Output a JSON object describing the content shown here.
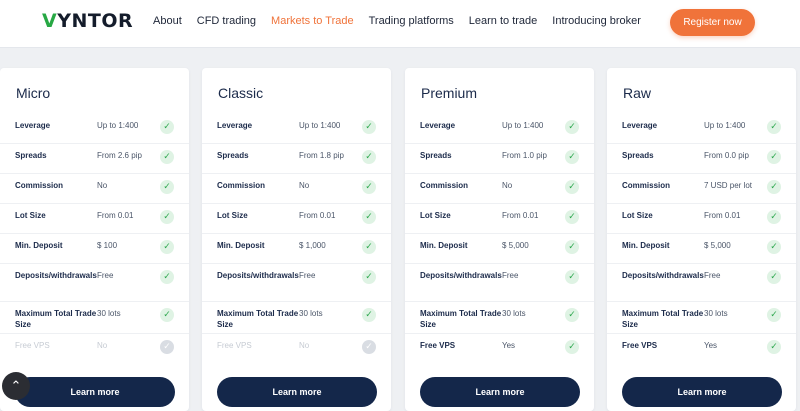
{
  "brand": {
    "logo_mark": "V",
    "logo_text": "YNTOR",
    "accent": "#f0733a",
    "brand_green": "#27a844",
    "navy": "#14274a"
  },
  "nav": {
    "items": [
      "About",
      "CFD trading",
      "Markets to Trade",
      "Trading platforms",
      "Learn to trade",
      "Introducing broker"
    ],
    "active_index": 2,
    "register_label": "Register now"
  },
  "cards": [
    {
      "title": "Micro",
      "rows": [
        {
          "label": "Leverage",
          "value": "Up to 1:400",
          "enabled": true
        },
        {
          "label": "Spreads",
          "value": "From 2.6 pip",
          "enabled": true
        },
        {
          "label": "Commission",
          "value": "No",
          "enabled": true
        },
        {
          "label": "Lot Size",
          "value": "From 0.01",
          "enabled": true
        },
        {
          "label": "Min. Deposit",
          "value": "$ 100",
          "enabled": true
        },
        {
          "label": "Deposits/withdrawals",
          "value": "Free",
          "enabled": true
        },
        {
          "label": "Maximum Total Trade Size",
          "value": "30 lots",
          "enabled": true
        },
        {
          "label": "Free VPS",
          "value": "No",
          "enabled": false
        }
      ],
      "button": "Learn more"
    },
    {
      "title": "Classic",
      "rows": [
        {
          "label": "Leverage",
          "value": "Up to 1:400",
          "enabled": true
        },
        {
          "label": "Spreads",
          "value": "From 1.8 pip",
          "enabled": true
        },
        {
          "label": "Commission",
          "value": "No",
          "enabled": true
        },
        {
          "label": "Lot Size",
          "value": "From 0.01",
          "enabled": true
        },
        {
          "label": "Min. Deposit",
          "value": "$ 1,000",
          "enabled": true
        },
        {
          "label": "Deposits/withdrawals",
          "value": "Free",
          "enabled": true
        },
        {
          "label": "Maximum Total Trade Size",
          "value": "30 lots",
          "enabled": true
        },
        {
          "label": "Free VPS",
          "value": "No",
          "enabled": false
        }
      ],
      "button": "Learn more"
    },
    {
      "title": "Premium",
      "rows": [
        {
          "label": "Leverage",
          "value": "Up to 1:400",
          "enabled": true
        },
        {
          "label": "Spreads",
          "value": "From 1.0 pip",
          "enabled": true
        },
        {
          "label": "Commission",
          "value": "No",
          "enabled": true
        },
        {
          "label": "Lot Size",
          "value": "From 0.01",
          "enabled": true
        },
        {
          "label": "Min. Deposit",
          "value": "$ 5,000",
          "enabled": true
        },
        {
          "label": "Deposits/withdrawals",
          "value": "Free",
          "enabled": true
        },
        {
          "label": "Maximum Total Trade Size",
          "value": "30 lots",
          "enabled": true
        },
        {
          "label": "Free VPS",
          "value": "Yes",
          "enabled": true
        }
      ],
      "button": "Learn more"
    },
    {
      "title": "Raw",
      "rows": [
        {
          "label": "Leverage",
          "value": "Up to 1:400",
          "enabled": true
        },
        {
          "label": "Spreads",
          "value": "From 0.0 pip",
          "enabled": true
        },
        {
          "label": "Commission",
          "value": "7 USD per lot",
          "enabled": true
        },
        {
          "label": "Lot Size",
          "value": "From 0.01",
          "enabled": true
        },
        {
          "label": "Min. Deposit",
          "value": "$ 5,000",
          "enabled": true
        },
        {
          "label": "Deposits/withdrawals",
          "value": "Free",
          "enabled": true
        },
        {
          "label": "Maximum Total Trade Size",
          "value": "30 lots",
          "enabled": true
        },
        {
          "label": "Free VPS",
          "value": "Yes",
          "enabled": true
        }
      ],
      "button": "Learn more"
    }
  ],
  "icons": {
    "check": "check-icon",
    "scroll_top": "chevron-up-icon"
  }
}
